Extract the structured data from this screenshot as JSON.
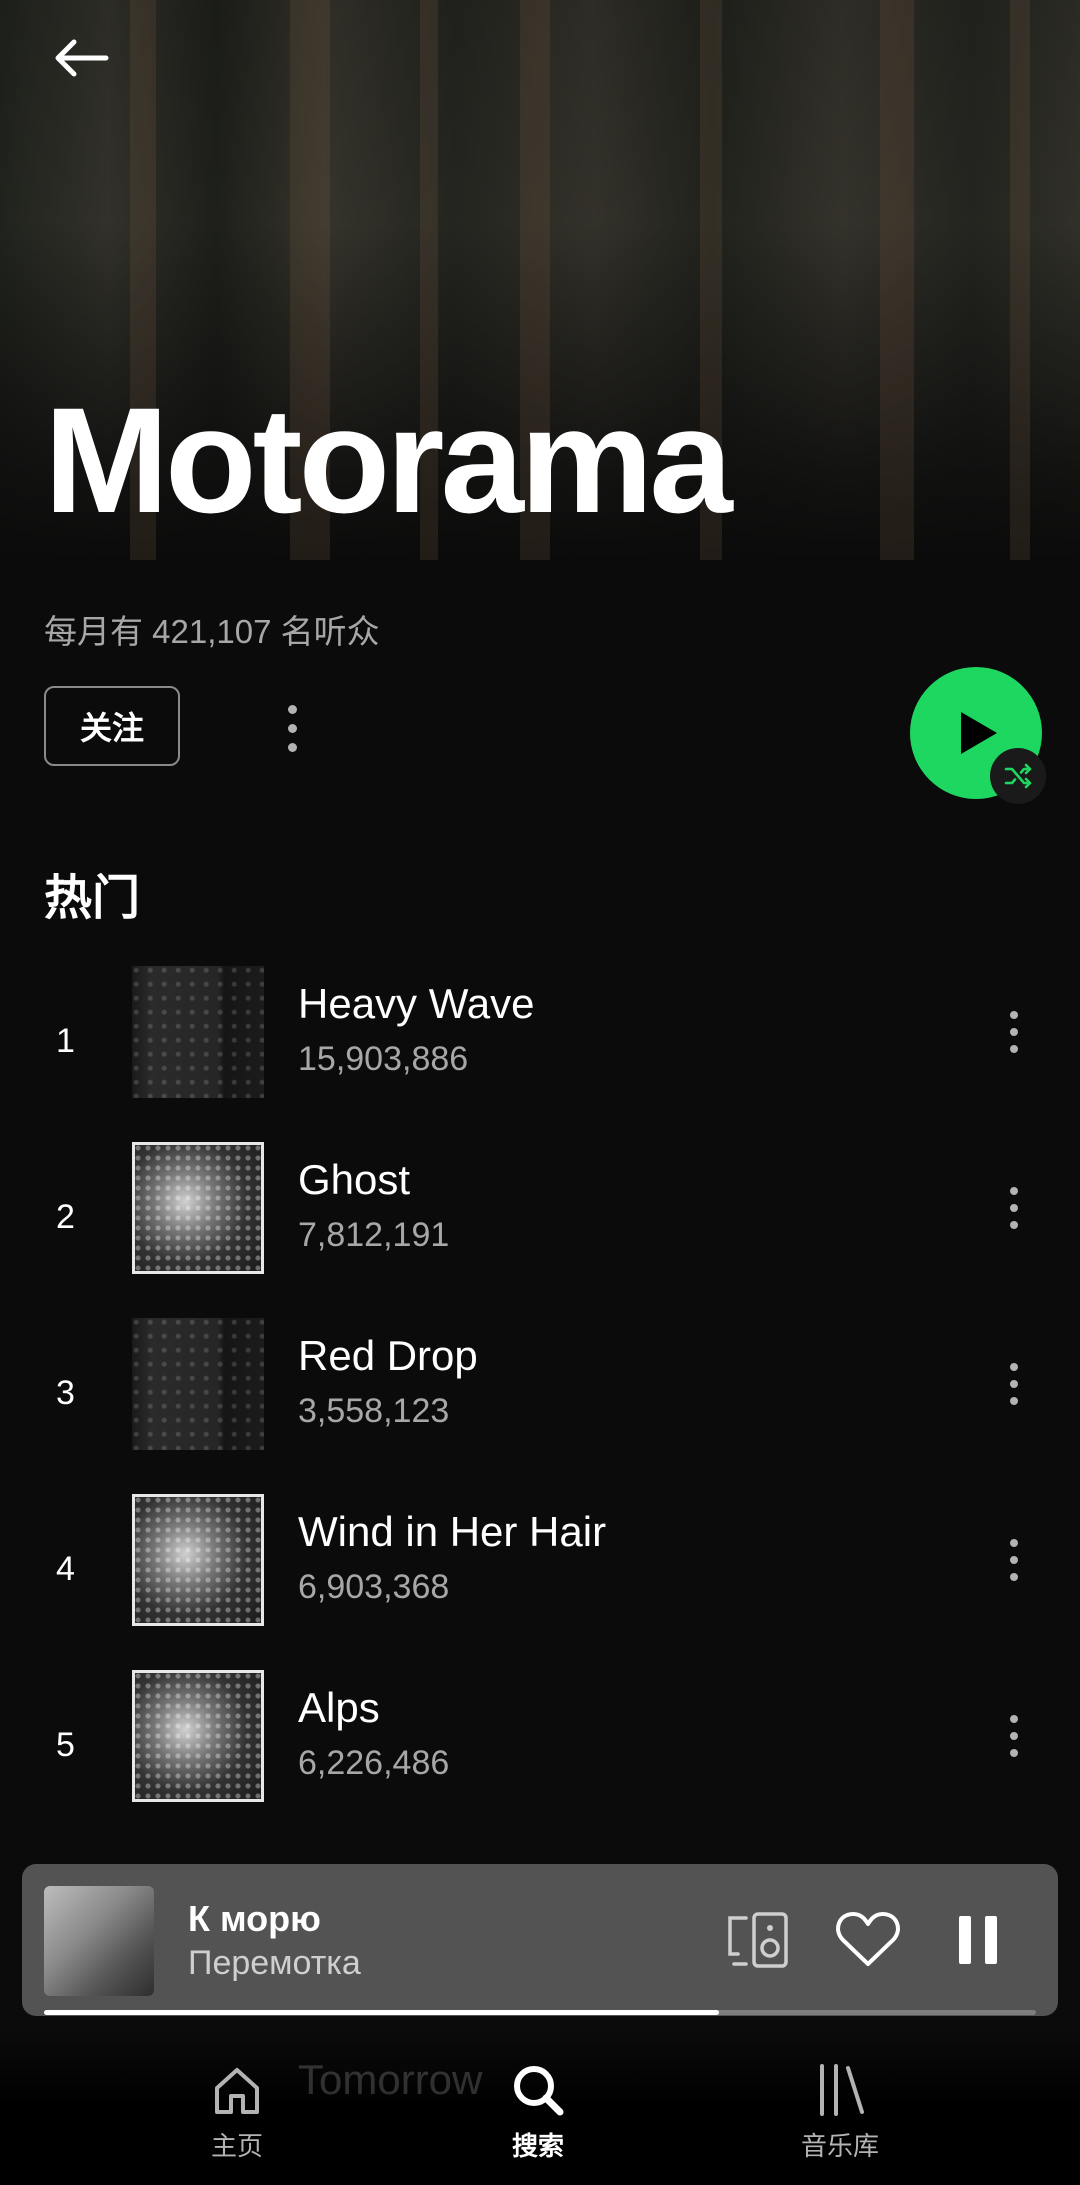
{
  "artist": {
    "name": "Motorama",
    "monthly_listeners": "每月有 421,107 名听众",
    "follow_label": "关注"
  },
  "section_title": "热门",
  "tracks": [
    {
      "rank": "1",
      "title": "Heavy Wave",
      "plays": "15,903,886",
      "art": "dark"
    },
    {
      "rank": "2",
      "title": "Ghost",
      "plays": "7,812,191",
      "art": "photo"
    },
    {
      "rank": "3",
      "title": "Red Drop",
      "plays": "3,558,123",
      "art": "dark"
    },
    {
      "rank": "4",
      "title": "Wind in Her Hair",
      "plays": "6,903,368",
      "art": "photo"
    },
    {
      "rank": "5",
      "title": "Alps",
      "plays": "6,226,486",
      "art": "photo"
    }
  ],
  "faded_track_title": "Tomorrow",
  "now_playing": {
    "title": "К морю",
    "artist": "Перемотка",
    "progress": 0.68
  },
  "nav": {
    "home": "主页",
    "search": "搜索",
    "library": "音乐库",
    "active": "search"
  },
  "colors": {
    "accent": "#1ed760",
    "background": "#0b0b0b",
    "mini_player": "#535353"
  },
  "icons": [
    "back-arrow-icon",
    "more-vertical-icon",
    "play-icon",
    "shuffle-icon",
    "connect-device-icon",
    "heart-icon",
    "pause-icon",
    "home-icon",
    "search-icon",
    "library-icon"
  ]
}
